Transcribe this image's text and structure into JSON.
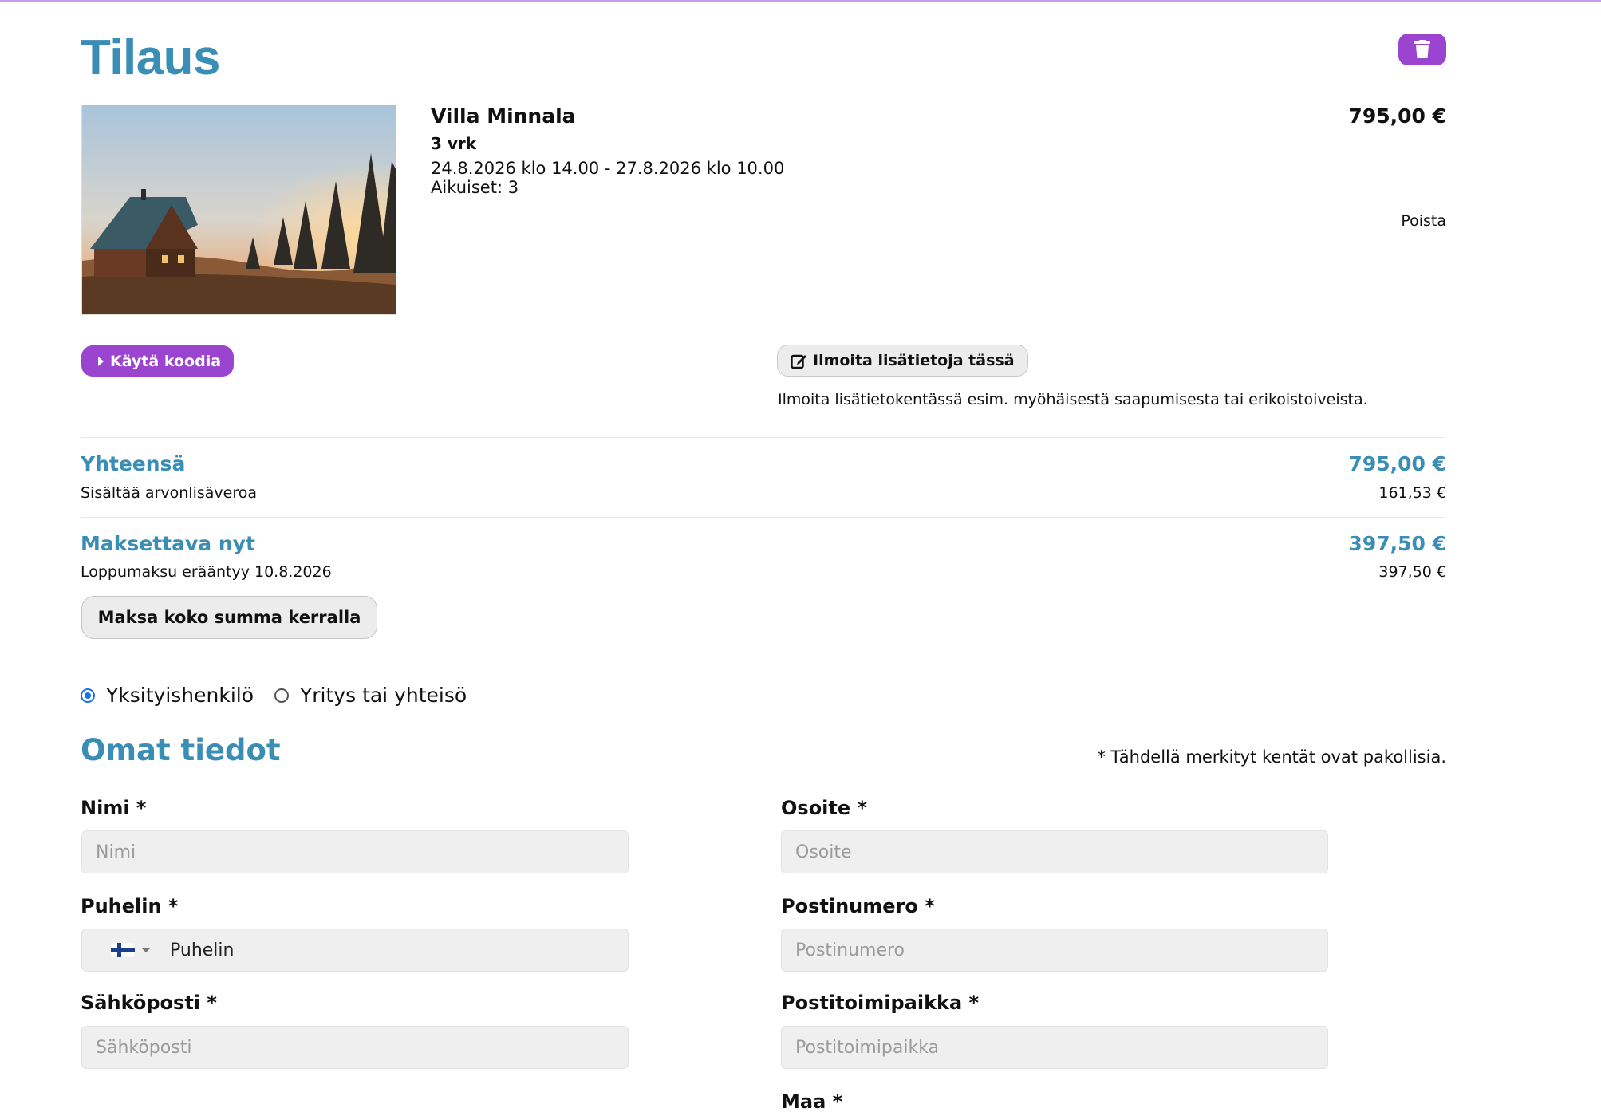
{
  "page": {
    "title": "Tilaus"
  },
  "product": {
    "name": "Villa Minnala",
    "duration": "3 vrk",
    "dates": "24.8.2026 klo 14.00 - 27.8.2026 klo 10.00",
    "guests": "Aikuiset: 3",
    "price": "795,00 €",
    "remove_label": "Poista"
  },
  "actions": {
    "code_label": "Käytä koodia",
    "notes_label": "Ilmoita lisätietoja tässä",
    "notes_hint": "Ilmoita lisätietokentässä esim. myöhäisestä saapumisesta tai erikoistoiveista."
  },
  "totals": {
    "total_label": "Yhteensä",
    "total_value": "795,00 €",
    "vat_label": "Sisältää arvonlisäveroa",
    "vat_value": "161,53 €",
    "due_label": "Maksettava nyt",
    "due_value": "397,50 €",
    "final_label": "Loppumaksu erääntyy 10.8.2026",
    "final_value": "397,50 €",
    "pay_full_label": "Maksa koko summa kerralla"
  },
  "customer_type": {
    "options": [
      "Yksityishenkilö",
      "Yritys tai yhteisö"
    ],
    "selected": "Yksityishenkilö"
  },
  "form": {
    "heading": "Omat tiedot",
    "required_note": "* Tähdellä merkityt kentät ovat pakollisia.",
    "name_label": "Nimi *",
    "name_placeholder": "Nimi",
    "phone_label": "Puhelin *",
    "phone_placeholder": "Puhelin",
    "email_label": "Sähköposti *",
    "email_placeholder": "Sähköposti",
    "address_label": "Osoite *",
    "address_placeholder": "Osoite",
    "zip_label": "Postinumero *",
    "zip_placeholder": "Postinumero",
    "city_label": "Postitoimipaikka *",
    "city_placeholder": "Postitoimipaikka",
    "country_label": "Maa *"
  },
  "colors": {
    "accent_blue": "#3a8db5",
    "accent_purple": "#9a44cf"
  }
}
